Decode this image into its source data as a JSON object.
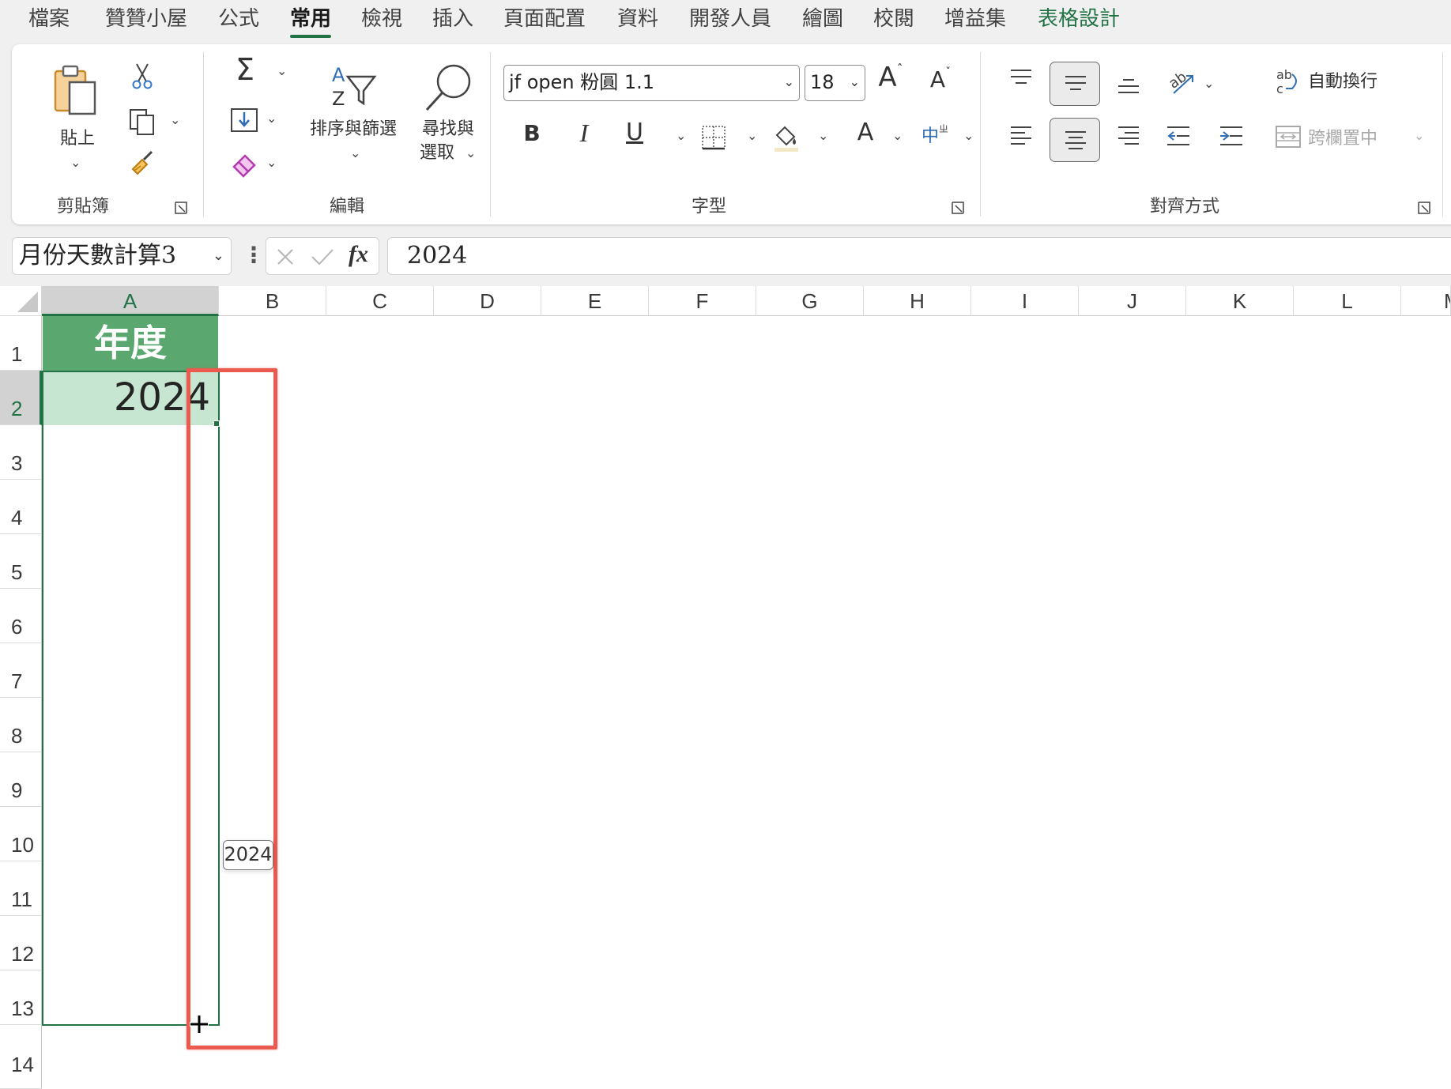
{
  "tabs": [
    {
      "label": "檔案",
      "id": "file"
    },
    {
      "label": "贊贊小屋",
      "id": "zanzan"
    },
    {
      "label": "公式",
      "id": "formulas"
    },
    {
      "label": "常用",
      "id": "home"
    },
    {
      "label": "檢視",
      "id": "view"
    },
    {
      "label": "插入",
      "id": "insert"
    },
    {
      "label": "頁面配置",
      "id": "page-layout"
    },
    {
      "label": "資料",
      "id": "data"
    },
    {
      "label": "開發人員",
      "id": "developer"
    },
    {
      "label": "繪圖",
      "id": "draw"
    },
    {
      "label": "校閱",
      "id": "review"
    },
    {
      "label": "增益集",
      "id": "addins"
    },
    {
      "label": "表格設計",
      "id": "table-design"
    }
  ],
  "ribbon": {
    "clipboard": {
      "group_label": "剪貼簿",
      "paste_label": "貼上"
    },
    "editing": {
      "group_label": "編輯",
      "sort_filter_label": "排序與篩選",
      "find_select_line1": "尋找與",
      "find_select_line2": "選取"
    },
    "font": {
      "group_label": "字型",
      "font_name": "jf open 粉圓 1.1",
      "font_size": "18"
    },
    "alignment": {
      "group_label": "對齊方式",
      "wrap_text_label": "自動換行",
      "merge_center_label": "跨欄置中"
    }
  },
  "formula_bar": {
    "name_box": "月份天數計算3",
    "fx_label": "fx",
    "formula": "2024"
  },
  "grid": {
    "columns": [
      "A",
      "B",
      "C",
      "D",
      "E",
      "F",
      "G",
      "H",
      "I",
      "J",
      "K",
      "L",
      "M"
    ],
    "selected_column": "A",
    "rows": [
      "1",
      "2",
      "3",
      "4",
      "5",
      "6",
      "7",
      "8",
      "9",
      "10",
      "11",
      "12",
      "13",
      "14"
    ],
    "selected_row": "2",
    "cells": {
      "A1": "年度",
      "A2": "2024"
    },
    "fill_tooltip": "2024"
  },
  "colors": {
    "accent": "#217346",
    "header_fill": "#5aa86f",
    "selected_fill": "#c6e6d2",
    "highlight": "#ea5a4e"
  },
  "icons": [
    "paste-icon",
    "cut-icon",
    "copy-icon",
    "format-painter-icon",
    "autosum-icon",
    "fill-icon",
    "clear-icon",
    "sort-filter-icon",
    "find-icon",
    "bold-icon",
    "italic-icon",
    "underline-icon",
    "borders-icon",
    "fill-color-icon",
    "font-color-icon",
    "phonetic-icon",
    "cancel-icon",
    "enter-icon",
    "crosshair-cursor-icon"
  ]
}
